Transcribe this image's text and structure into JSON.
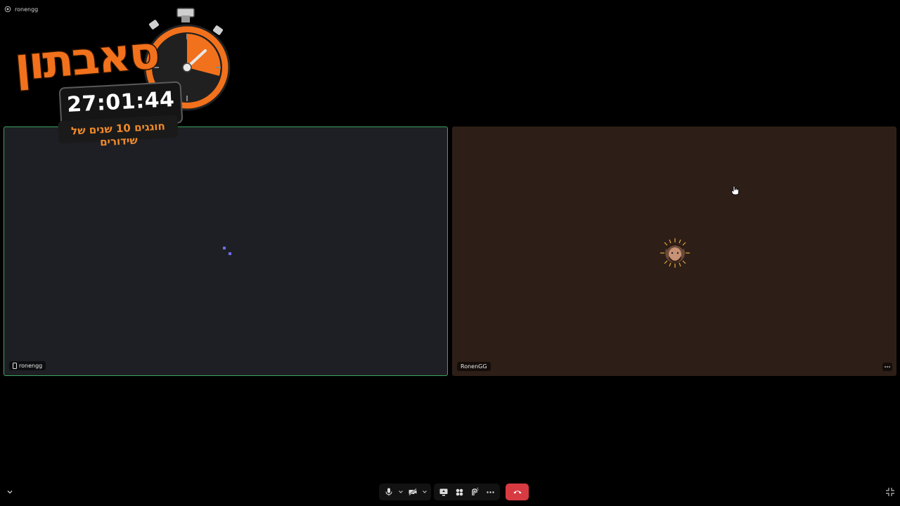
{
  "channel": {
    "name": "ronengg",
    "icon": "stage-icon"
  },
  "overlay": {
    "title": "סאבתון",
    "timer": "27:01:44",
    "subtitle": "חוגגים 10 שנים של שידורים",
    "colors": {
      "primary": "#f2711c",
      "dark": "#151515"
    }
  },
  "tiles": [
    {
      "username": "ronengg",
      "state": "loading",
      "icon": "mobile-phone-icon",
      "border_color": "#3ba55d"
    },
    {
      "username": "RonenGG",
      "state": "avatar",
      "more_icon": "more-horizontal-icon"
    }
  ],
  "toolbar": {
    "buttons": [
      "microphone-icon",
      "chevron-down-icon",
      "camera-off-icon",
      "chevron-down-icon",
      "screen-share-icon",
      "activities-icon",
      "soundboard-icon",
      "more-icon"
    ],
    "hangup": {
      "icon": "hang-up-icon",
      "color": "#d83a42"
    }
  },
  "corner": {
    "collapse_icon": "chevron-down-icon",
    "fullscreen_icon": "exit-fullscreen-icon"
  }
}
